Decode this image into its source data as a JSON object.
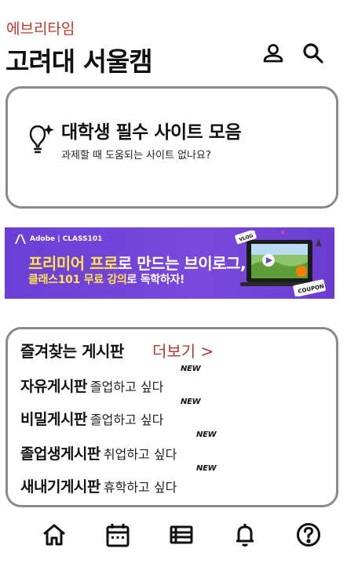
{
  "header": {
    "app_brand": "에브리타임",
    "school": "고려대 서울캠",
    "icons": [
      "profile-icon",
      "search-icon"
    ]
  },
  "promo": {
    "icon": "lightbulb-sparkle-icon",
    "title": "대학생 필수 사이트 모음",
    "subtitle": "과제할 때 도움되는 사이트 없나요?"
  },
  "ad": {
    "brand": "Adobe | CLASS101",
    "line1_highlight": "프리미어 프로",
    "line1_rest": "로 만드는 브이로그,",
    "line2_highlight": "클래스101 무료 강의",
    "line2_rest": "로 독학하자!",
    "art_labels": [
      "VLOG",
      "COUPON"
    ],
    "accent_color": "#6b3fd6",
    "highlight_color": "#ffe34d"
  },
  "boards": {
    "title": "즐겨찾는 게시판",
    "more_label": "더보기 >",
    "more_color": "#b03a2e",
    "badge": "NEW",
    "items": [
      {
        "name": "자유게시판",
        "preview": "졸업하고 싶다"
      },
      {
        "name": "비밀게시판",
        "preview": "졸업하고 싶다"
      },
      {
        "name": "졸업생게시판",
        "preview": "취업하고 싶다"
      },
      {
        "name": "새내기게시판",
        "preview": "휴학하고 싶다"
      }
    ]
  },
  "bottom_nav": [
    "home-icon",
    "calendar-icon",
    "list-icon",
    "bell-icon",
    "help-icon"
  ]
}
